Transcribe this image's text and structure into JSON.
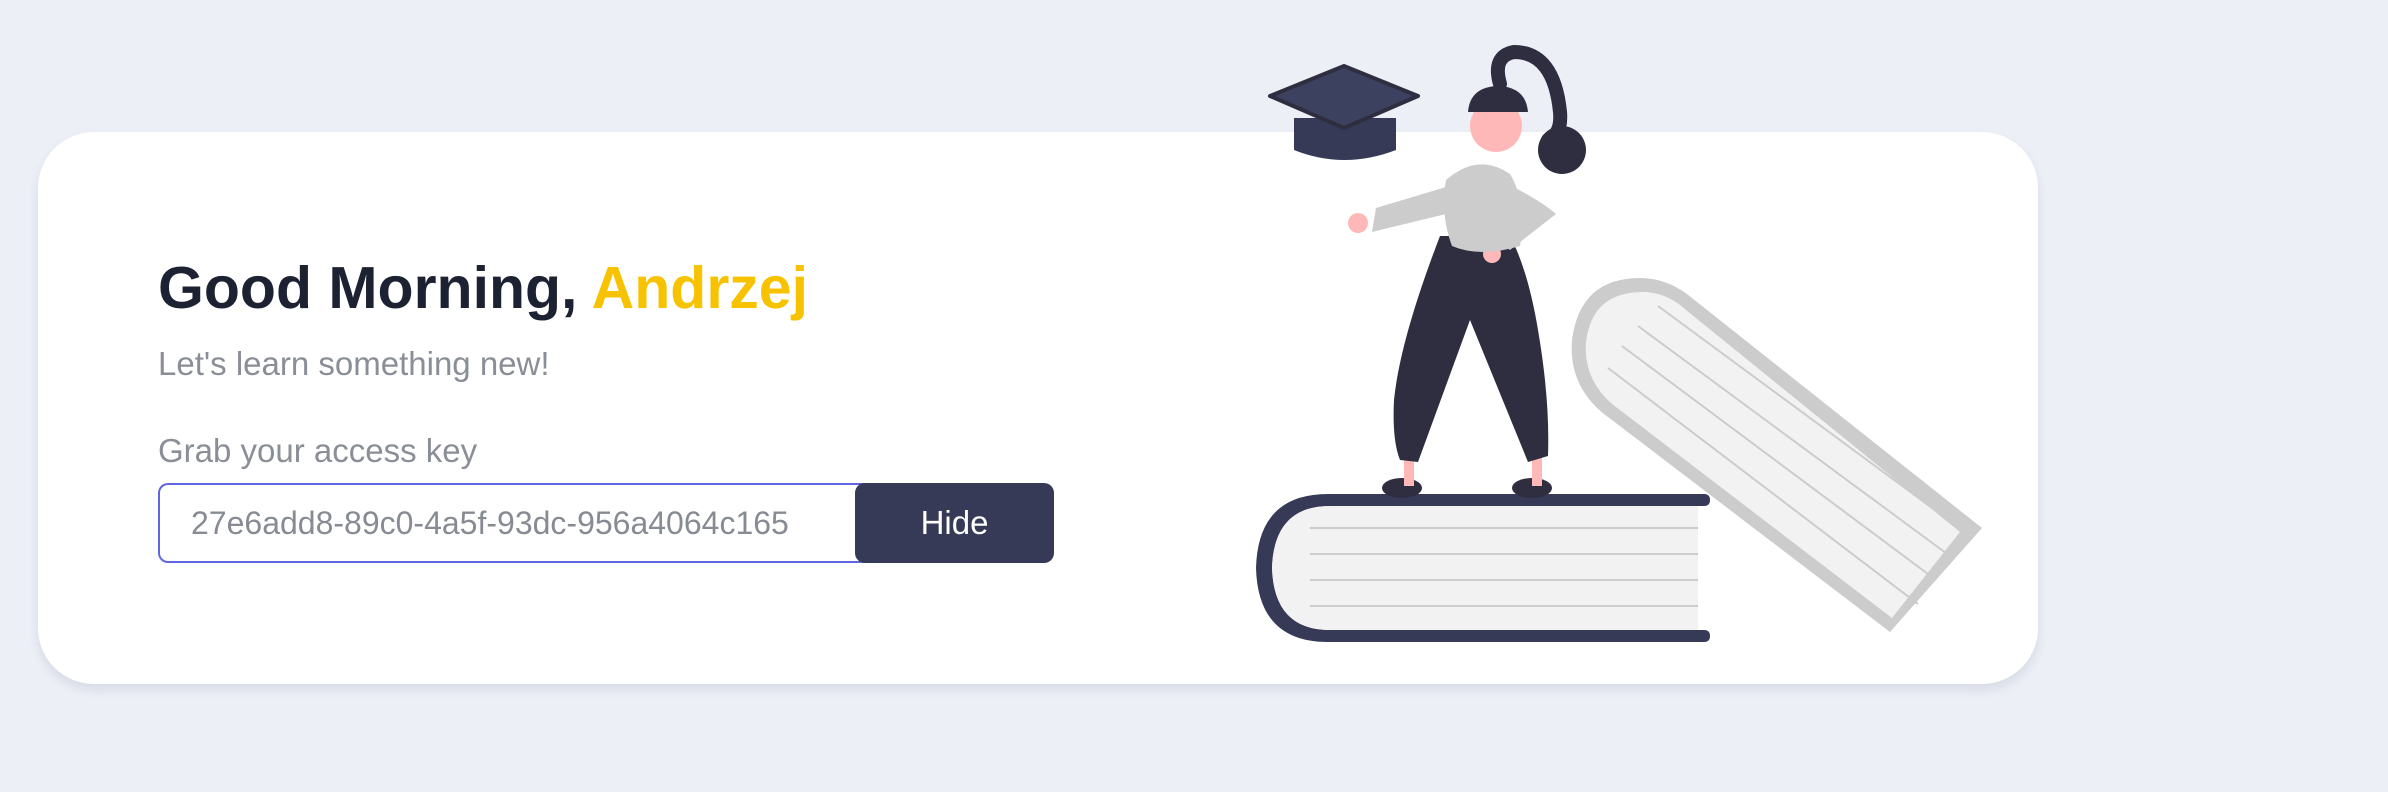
{
  "greeting": {
    "prefix": "Good Morning, ",
    "name": "Andrzej",
    "subtitle": "Let's learn something new!"
  },
  "access_key": {
    "label": "Grab your access key",
    "value": "27e6add8-89c0-4a5f-93dc-956a4064c165",
    "button_label": "Hide"
  },
  "colors": {
    "page_background": "#eceff6",
    "card_background": "#ffffff",
    "heading_text": "#1c2231",
    "name_accent": "#f7c300",
    "muted_text": "#8a8e96",
    "input_border": "#5f66df",
    "button_background": "#363a56",
    "button_text": "#ffffff"
  },
  "illustration": {
    "name": "student-on-books-illustration",
    "elements": [
      "graduation-cap",
      "woman-figure",
      "closed-book-lying",
      "tilted-book"
    ]
  }
}
